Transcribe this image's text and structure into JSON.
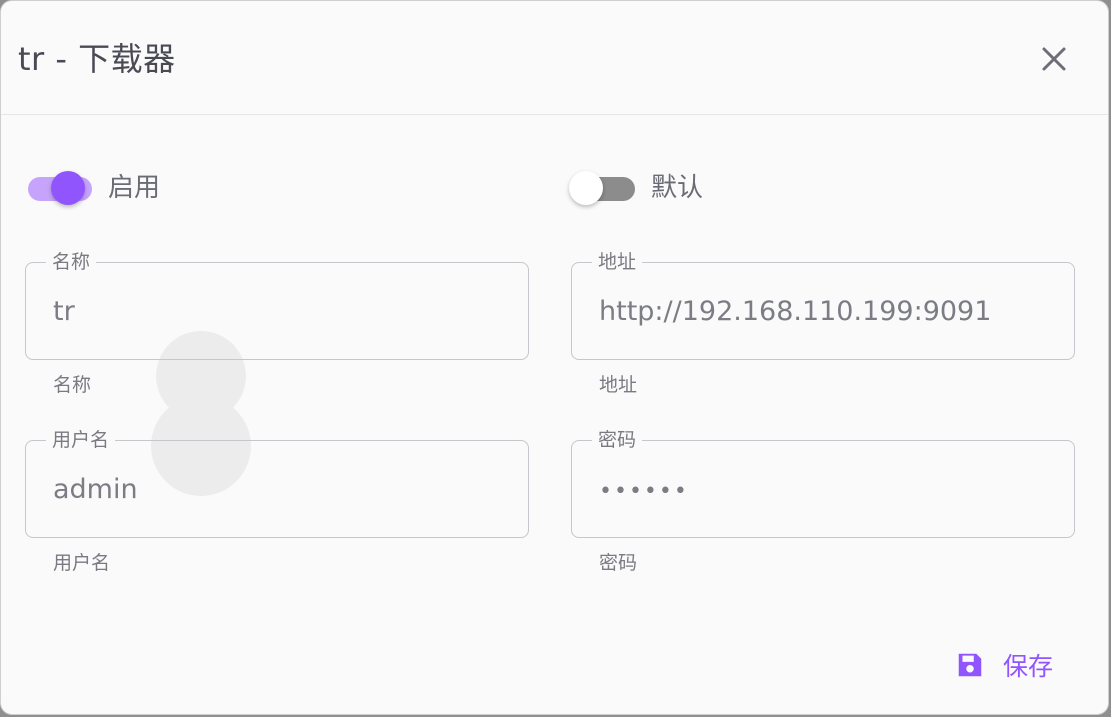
{
  "dialog": {
    "title": "tr - 下载器",
    "close_icon": "close-icon"
  },
  "switches": {
    "enabled": {
      "label": "启用",
      "on": true
    },
    "default": {
      "label": "默认",
      "on": false
    }
  },
  "fields": {
    "name": {
      "legend": "名称",
      "value": "tr",
      "hint": "名称"
    },
    "address": {
      "legend": "地址",
      "value": "http://192.168.110.199:9091",
      "hint": "地址"
    },
    "username": {
      "legend": "用户名",
      "value": "admin",
      "hint": "用户名"
    },
    "password": {
      "legend": "密码",
      "value": "••••••",
      "hint": "密码"
    }
  },
  "actions": {
    "save_label": "保存",
    "save_icon": "floppy-disk-icon"
  },
  "colors": {
    "accent": "#9155fd",
    "accent_light": "#c7a4fb",
    "switch_off_track": "#8c8c8c",
    "text": "#4a4a55",
    "muted": "#7a7a82",
    "border": "#c6c6cc",
    "surface": "#fafafa"
  }
}
